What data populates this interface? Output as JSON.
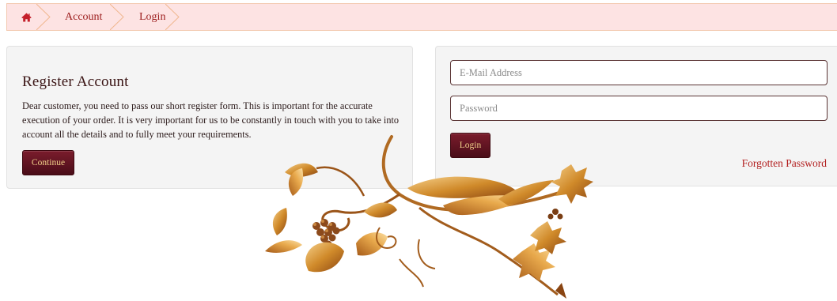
{
  "breadcrumb": {
    "home_icon": "home-icon",
    "items": [
      {
        "label": "Account"
      },
      {
        "label": "Login"
      }
    ]
  },
  "register": {
    "title": "Register Account",
    "description": "Dear customer, you need to pass our short register form. This is important for the accurate execution of your order. It is very important for us to be constantly in touch with you to take into account all the details and to fully meet your requirements.",
    "continue_label": "Continue"
  },
  "login": {
    "email_placeholder": "E-Mail Address",
    "password_placeholder": "Password",
    "login_label": "Login",
    "forgotten_password_label": "Forgotten Password"
  },
  "colors": {
    "accent": "#9b1b1b",
    "breadcrumb_bg": "#fde3e3",
    "button_bg": "#5e1220",
    "button_text": "#f1d28a",
    "ornament": "#c98a2e"
  },
  "decoration": {
    "icon": "floral-ornament-icon"
  }
}
